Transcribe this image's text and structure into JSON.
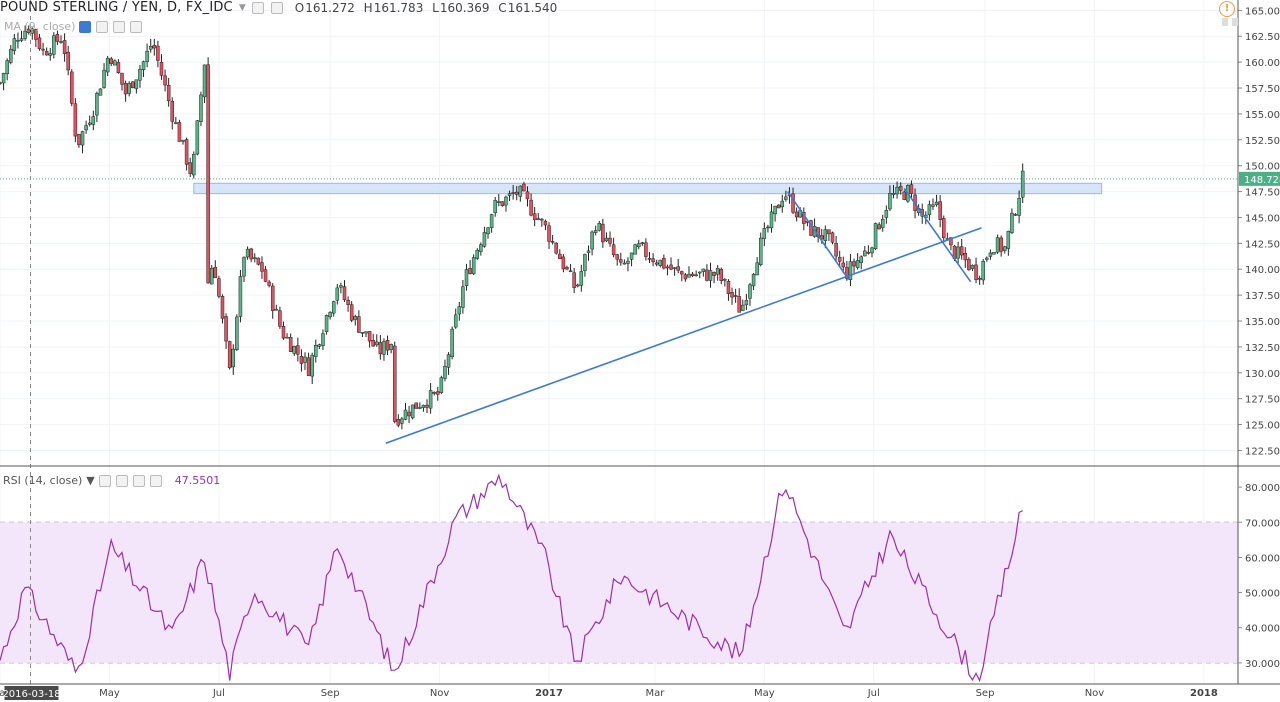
{
  "header": {
    "symbol_title": "POUND STERLING / YEN, D, FX_IDC",
    "ohlc": {
      "open_label": "O",
      "open": "161.272",
      "high_label": "H",
      "high": "161.783",
      "low_label": "L",
      "low": "160.369",
      "close_label": "C",
      "close": "161.540"
    },
    "ma_label": "MA (9, close)"
  },
  "rsi_legend": {
    "label": "RSI (14, close)",
    "value": "47.5501"
  },
  "crosshair_date": "2016-03-18",
  "colors": {
    "up_candle": "#53b987",
    "down_candle": "#eb4d5c",
    "wick": "#222222",
    "trendline": "#3a7bd5",
    "resistance_zone": "#cfe2f7",
    "rsi_line": "#9b2fae",
    "rsi_band": "#f3e6fb",
    "price_badge": "#4caf88"
  },
  "chart_data": [
    {
      "type": "candlestick",
      "title": "POUND STERLING / YEN, D, FX_IDC",
      "x_unit": "date",
      "xlim": [
        "2016-03-01",
        "2018-01-20"
      ],
      "y_ticks": [
        "122.500",
        "125.000",
        "127.500",
        "130.000",
        "132.500",
        "135.000",
        "137.500",
        "140.000",
        "142.500",
        "145.000",
        "147.500",
        "150.000",
        "152.500",
        "155.000",
        "157.500",
        "160.000",
        "162.500",
        "165.000"
      ],
      "ylim": [
        121,
        166
      ],
      "x_tick_labels": [
        "Mar",
        "May",
        "Jul",
        "Sep",
        "Nov",
        "2017",
        "Mar",
        "May",
        "Jul",
        "Sep",
        "Nov",
        "2018"
      ],
      "last_price": "148.728",
      "grid": true,
      "anchors": [
        {
          "date": "2016-03-01",
          "close": 158
        },
        {
          "date": "2016-03-10",
          "close": 162.5
        },
        {
          "date": "2016-03-18",
          "close": 163.5
        },
        {
          "date": "2016-03-25",
          "close": 161
        },
        {
          "date": "2016-04-05",
          "close": 162.5
        },
        {
          "date": "2016-04-13",
          "close": 152
        },
        {
          "date": "2016-04-22",
          "close": 155.5
        },
        {
          "date": "2016-05-01",
          "close": 161
        },
        {
          "date": "2016-05-10",
          "close": 157
        },
        {
          "date": "2016-05-20",
          "close": 160
        },
        {
          "date": "2016-05-25",
          "close": 162
        },
        {
          "date": "2016-06-05",
          "close": 155
        },
        {
          "date": "2016-06-16",
          "close": 149
        },
        {
          "date": "2016-06-23",
          "close": 160
        },
        {
          "date": "2016-06-24",
          "close": 138
        },
        {
          "date": "2016-06-28",
          "close": 141
        },
        {
          "date": "2016-07-07",
          "close": 130
        },
        {
          "date": "2016-07-15",
          "close": 141.5
        },
        {
          "date": "2016-07-25",
          "close": 140
        },
        {
          "date": "2016-08-05",
          "close": 134
        },
        {
          "date": "2016-08-20",
          "close": 130.5
        },
        {
          "date": "2016-09-05",
          "close": 138.5
        },
        {
          "date": "2016-09-15",
          "close": 135
        },
        {
          "date": "2016-09-28",
          "close": 132
        },
        {
          "date": "2016-10-05",
          "close": 133
        },
        {
          "date": "2016-10-07",
          "close": 125.5
        },
        {
          "date": "2016-10-20",
          "close": 127
        },
        {
          "date": "2016-11-01",
          "close": 128
        },
        {
          "date": "2016-11-15",
          "close": 139
        },
        {
          "date": "2016-12-01",
          "close": 146
        },
        {
          "date": "2016-12-15",
          "close": 147.5
        },
        {
          "date": "2016-12-30",
          "close": 144
        },
        {
          "date": "2017-01-16",
          "close": 138
        },
        {
          "date": "2017-01-27",
          "close": 144.5
        },
        {
          "date": "2017-02-10",
          "close": 140
        },
        {
          "date": "2017-02-20",
          "close": 142
        },
        {
          "date": "2017-03-15",
          "close": 139.5
        },
        {
          "date": "2017-04-05",
          "close": 139.5
        },
        {
          "date": "2017-04-18",
          "close": 136
        },
        {
          "date": "2017-04-28",
          "close": 142
        },
        {
          "date": "2017-05-12",
          "close": 147.5
        },
        {
          "date": "2017-05-25",
          "close": 144
        },
        {
          "date": "2017-06-05",
          "close": 143
        },
        {
          "date": "2017-06-15",
          "close": 139.5
        },
        {
          "date": "2017-06-28",
          "close": 142
        },
        {
          "date": "2017-07-10",
          "close": 147
        },
        {
          "date": "2017-07-20",
          "close": 147.5
        },
        {
          "date": "2017-07-28",
          "close": 145
        },
        {
          "date": "2017-08-05",
          "close": 146
        },
        {
          "date": "2017-08-12",
          "close": 142
        },
        {
          "date": "2017-08-20",
          "close": 141
        },
        {
          "date": "2017-08-28",
          "close": 139.5
        },
        {
          "date": "2017-09-05",
          "close": 142.5
        },
        {
          "date": "2017-09-12",
          "close": 142
        },
        {
          "date": "2017-09-18",
          "close": 146
        },
        {
          "date": "2017-09-22",
          "close": 148.7
        }
      ]
    },
    {
      "type": "line",
      "title": "RSI (14, close)",
      "x_unit": "date",
      "ylim": [
        24,
        86
      ],
      "y_ticks": [
        "30.0000",
        "40.0000",
        "50.0000",
        "60.0000",
        "70.0000",
        "80.0000"
      ],
      "band": [
        30,
        70
      ],
      "last_value": "47.5501",
      "anchors": [
        {
          "date": "2016-03-01",
          "value": 31
        },
        {
          "date": "2016-03-15",
          "value": 51
        },
        {
          "date": "2016-04-13",
          "value": 27
        },
        {
          "date": "2016-05-02",
          "value": 63
        },
        {
          "date": "2016-06-05",
          "value": 38
        },
        {
          "date": "2016-06-23",
          "value": 60
        },
        {
          "date": "2016-07-07",
          "value": 27
        },
        {
          "date": "2016-07-20",
          "value": 51
        },
        {
          "date": "2016-08-20",
          "value": 34
        },
        {
          "date": "2016-09-05",
          "value": 64
        },
        {
          "date": "2016-10-07",
          "value": 27
        },
        {
          "date": "2016-11-10",
          "value": 71
        },
        {
          "date": "2016-12-05",
          "value": 83
        },
        {
          "date": "2016-12-30",
          "value": 60
        },
        {
          "date": "2017-01-16",
          "value": 30
        },
        {
          "date": "2017-02-10",
          "value": 55
        },
        {
          "date": "2017-04-18",
          "value": 32
        },
        {
          "date": "2017-05-12",
          "value": 82
        },
        {
          "date": "2017-06-15",
          "value": 38
        },
        {
          "date": "2017-07-10",
          "value": 66
        },
        {
          "date": "2017-08-28",
          "value": 25
        },
        {
          "date": "2017-09-22",
          "value": 74
        }
      ]
    }
  ]
}
